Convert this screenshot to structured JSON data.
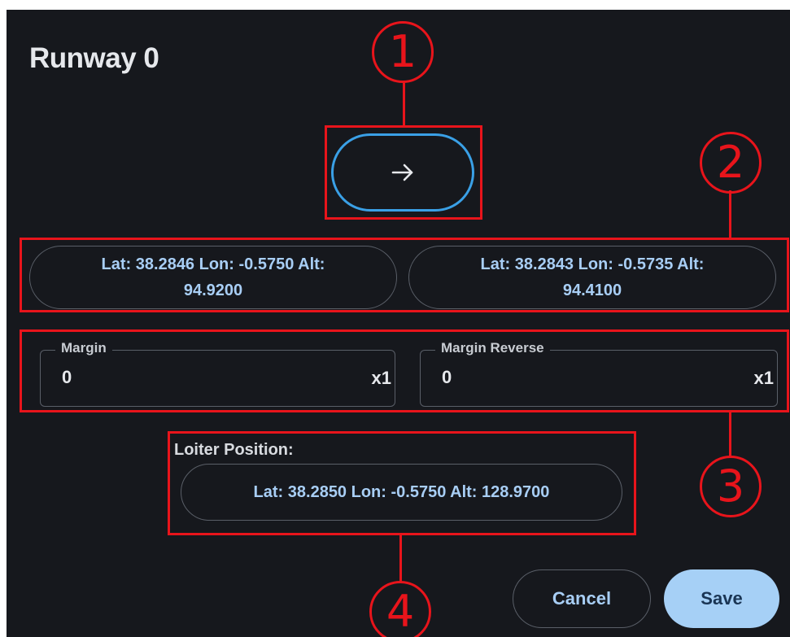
{
  "dialog": {
    "title": "Runway 0",
    "direction_icon": "arrow-right-icon",
    "runway_start": {
      "line1": "Lat: 38.2846 Lon: -0.5750 Alt:",
      "line2": "94.9200"
    },
    "runway_end": {
      "line1": "Lat: 38.2843 Lon: -0.5735 Alt:",
      "line2": "94.4100"
    },
    "margin": {
      "label": "Margin",
      "value": "0",
      "suffix": "x1"
    },
    "margin_reverse": {
      "label": "Margin Reverse",
      "value": "0",
      "suffix": "x1"
    },
    "loiter": {
      "label": "Loiter Position:",
      "value": "Lat: 38.2850 Lon: -0.5750 Alt: 128.9700"
    },
    "cancel_label": "Cancel",
    "save_label": "Save"
  },
  "annotations": {
    "marker_1": "1",
    "marker_2": "2",
    "marker_3": "3",
    "marker_4": "4",
    "color": "#e8141b"
  },
  "colors": {
    "background": "#16181d",
    "accent_border": "#3aa0e6",
    "link_text": "#a8cef5",
    "primary_button": "#a6d0f6"
  }
}
